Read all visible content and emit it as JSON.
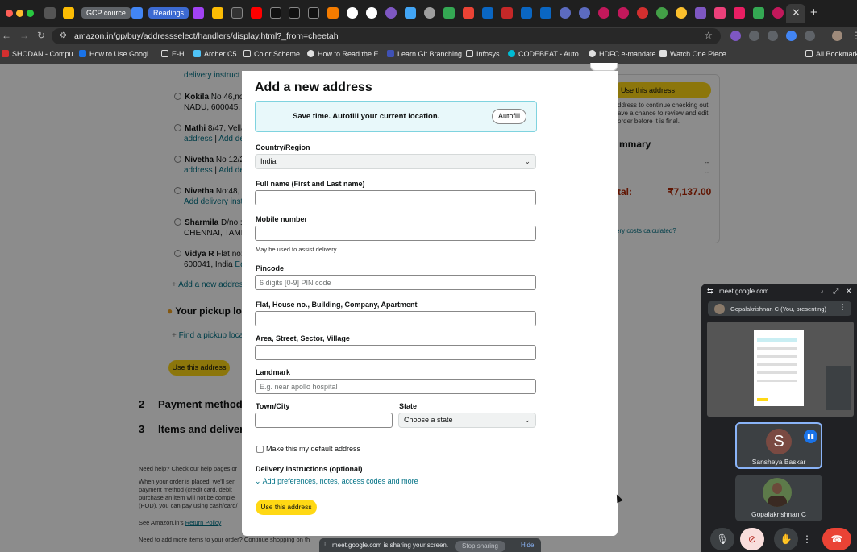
{
  "browser": {
    "tabs": {
      "gcp_course": "GCP cource",
      "readings": "Readings"
    },
    "url": "amazon.in/gp/buy/addressselect/handlers/display.html?_from=cheetah",
    "bookmarks": [
      {
        "label": "SHODAN - Compu...",
        "color": "#d32f2f"
      },
      {
        "label": "How to Use Googl...",
        "color": "#1a73e8"
      },
      {
        "label": "E-H",
        "color": "folder"
      },
      {
        "label": "Archer C5",
        "color": "#4fc3f7"
      },
      {
        "label": "Color Scheme",
        "color": "folder"
      },
      {
        "label": "How to Read the E...",
        "color": "#e0e0e0"
      },
      {
        "label": "Learn Git Branching",
        "color": "#3f51b5"
      },
      {
        "label": "Infosys",
        "color": "folder"
      },
      {
        "label": "CODEBEAT - Auto...",
        "color": "#00bcd4"
      },
      {
        "label": "HDFC e-mandate",
        "color": "#e0e0e0"
      },
      {
        "label": "Watch One Piece...",
        "color": "#e0e0e0"
      }
    ],
    "all_bookmarks": "All Bookmarks"
  },
  "background_page": {
    "addresses": [
      {
        "name": "Kokila",
        "line1": "No 46,nor",
        "line2": "NADU, 600045, I"
      },
      {
        "name": "Mathi",
        "line1": "8/47, Vella",
        "line2a": "address",
        "line2b": "Add deli"
      },
      {
        "name": "Nivetha",
        "line1": "No 12/2",
        "line2a": "address",
        "line2b": "Add deli"
      },
      {
        "name": "Nivetha",
        "line1": "No:48, IC",
        "line2": "Add delivery instr"
      },
      {
        "name": "Sharmila",
        "line1": "D/no :",
        "line2": "CHENNAI, TAMIL"
      },
      {
        "name": "Vidya R",
        "line1": "Flat no: 1",
        "line2a": "600041, India",
        "line2b": "Edi"
      }
    ],
    "top_partial": "delivery instruct",
    "add_new": "Add a new addres",
    "pickup_title": "Your pickup lo",
    "find_pickup": "Find a pickup loca",
    "use_address": "Use this address",
    "section2_num": "2",
    "section2": "Payment method",
    "section3_num": "3",
    "section3": "Items and delivery",
    "help": "Need help? Check our help pages or",
    "help_link": "help pages",
    "footer1": "When your order is placed, we'll sen",
    "footer2": "payment method (credit card, debit",
    "footer3": "purchase an item will not be comple",
    "footer4": "(POD), you can pay using cash/card/",
    "see_policy": "See Amazon.in's",
    "return_policy": "Return Policy",
    "need_more": "Need to add more items to your order? Continue shopping on th",
    "right_panel": {
      "use_address": "Use this address",
      "note1": "ddress to continue checking out.",
      "note2": "ave a chance to review and edit",
      "note3": "order before it is final.",
      "summary": "mmary",
      "dash1": "--",
      "dash2": "--",
      "total_label": "tal:",
      "total_value": "₹7,137.00",
      "delivery_costs": "ery costs calculated?"
    }
  },
  "modal": {
    "title": "Add a new address",
    "autofill_text": "Save time. Autofill your current location.",
    "autofill_button": "Autofill",
    "country_label": "Country/Region",
    "country_value": "India",
    "fullname_label": "Full name (First and Last name)",
    "mobile_label": "Mobile number",
    "mobile_hint": "May be used to assist delivery",
    "pincode_label": "Pincode",
    "pincode_placeholder": "6 digits [0-9] PIN code",
    "flat_label": "Flat, House no., Building, Company, Apartment",
    "area_label": "Area, Street, Sector, Village",
    "landmark_label": "Landmark",
    "landmark_placeholder": "E.g. near apollo hospital",
    "town_label": "Town/City",
    "state_label": "State",
    "state_value": "Choose a state",
    "default_label": "Make this my default address",
    "delivery_title": "Delivery instructions (optional)",
    "delivery_link": "Add preferences, notes, access codes and more",
    "submit": "Use this address"
  },
  "sharebar": {
    "text": "meet.google.com is sharing your screen.",
    "stop": "Stop sharing",
    "hide": "Hide"
  },
  "meet": {
    "title": "meet.google.com",
    "presenting": "Gopalakrishnan C (You, presenting)",
    "participant1_initial": "S",
    "participant1": "Sansheya Baskar",
    "participant2": "Gopalakrishnan C"
  }
}
